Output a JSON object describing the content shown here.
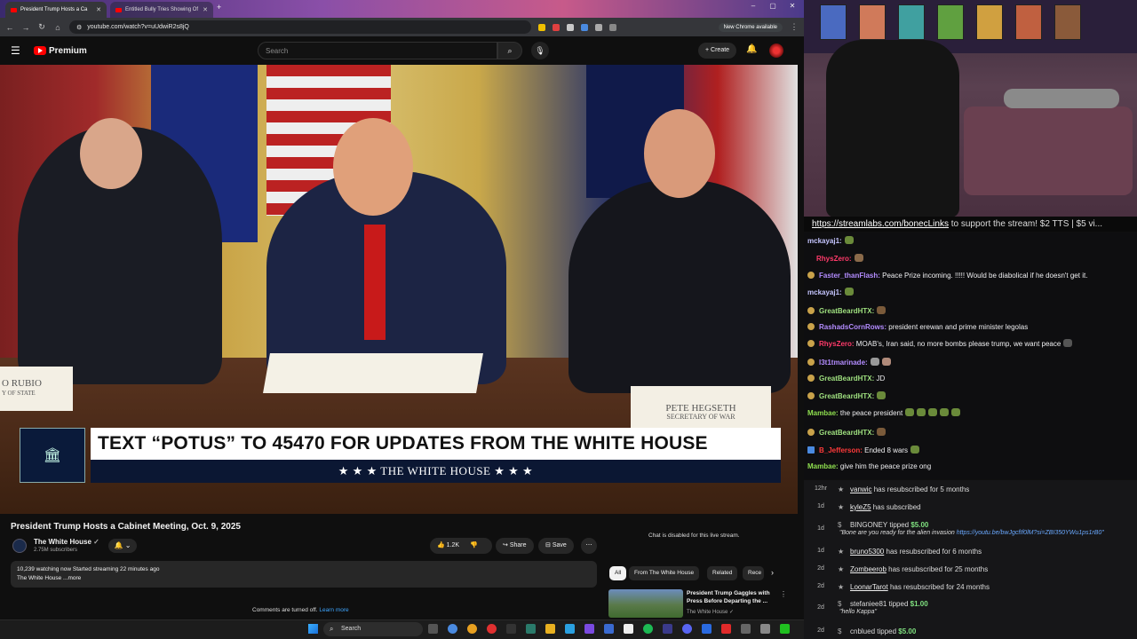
{
  "browser": {
    "tabs": [
      {
        "label": "President Trump Hosts a Ca"
      },
      {
        "label": "Entitled Bully Tries Showing Of"
      }
    ],
    "url": "youtube.com/watch?v=uUdwiR2s8jQ",
    "chrome_badge": "New Chrome available"
  },
  "youtube": {
    "logo": "Premium",
    "search_placeholder": "Search",
    "create_label": "Create",
    "video": {
      "banner_text": "TEXT “POTUS” TO 45470 FOR UPDATES FROM THE WHITE HOUSE",
      "banner_sub": "★ ★ ★   THE WHITE HOUSE   ★ ★ ★",
      "nameplate_left_name": "O RUBIO",
      "nameplate_left_title": "Y OF STATE",
      "nameplate_right_name": "PETE HEGSETH",
      "nameplate_right_title": "SECRETARY OF WAR"
    },
    "title": "President Trump Hosts a Cabinet Meeting, Oct. 9, 2025",
    "channel": "The White House",
    "subscribers": "2.75M subscribers",
    "likes": "1.2K",
    "share_label": "Share",
    "save_label": "Save",
    "description_line1": "10,239 watching now  Started streaming 22 minutes ago",
    "description_line2": "The White House ...more",
    "comments_off": "Comments are turned off.",
    "learn_more": "Learn more",
    "chat_disabled": "Chat is disabled for this live stream.",
    "chips": [
      "All",
      "From The White House",
      "Related",
      "Rece"
    ],
    "recommendation": {
      "title": "President Trump Gaggles with Press Before Departing the ...",
      "channel": "The White House"
    }
  },
  "taskbar": {
    "search": "Search"
  },
  "stream": {
    "ticker_link": "https://streamlabs.com/bonecLinks",
    "ticker_rest": " to support the stream! $2 TTS | $5 vi...",
    "chat": [
      {
        "user": "mckayaj1:",
        "color": "#c5c5ff",
        "text": ""
      },
      {
        "user": "RhysZero:",
        "color": "#ff3a6a",
        "text": ""
      },
      {
        "user": "Faster_thanFlash:",
        "color": "#b38cff",
        "text": "Peace Prize incoming. !!!!! Would be diabolical if he doesn't get it."
      },
      {
        "user": "mckayaj1:",
        "color": "#c5c5ff",
        "text": ""
      },
      {
        "user": "GreatBeardHTX:",
        "color": "#9fe07f",
        "text": ""
      },
      {
        "user": "RashadsCornRows:",
        "color": "#b38cff",
        "text": "president erewan and prime minister legolas"
      },
      {
        "user": "RhysZero:",
        "color": "#ff3a6a",
        "text": "MOAB's, Iran said, no more bombs please trump, we want peace"
      },
      {
        "user": "l3t1tmarinade:",
        "color": "#b38cff",
        "text": ""
      },
      {
        "user": "GreatBeardHTX:",
        "color": "#9fe07f",
        "text": "JD"
      },
      {
        "user": "GreatBeardHTX:",
        "color": "#9fe07f",
        "text": ""
      },
      {
        "user": "Mambae:",
        "color": "#8fe04f",
        "text": "the peace president"
      },
      {
        "user": "GreatBeardHTX:",
        "color": "#9fe07f",
        "text": ""
      },
      {
        "user": "B_Jefferson:",
        "color": "#ff3a3a",
        "text": "Ended 8 wars"
      },
      {
        "user": "Mambae:",
        "color": "#8fe04f",
        "text": "give him the peace prize ong"
      }
    ],
    "events": [
      {
        "time": "12hr",
        "name": "vanwic",
        "action": "has resubscribed for 5 months"
      },
      {
        "time": "1d",
        "name": "kyleZ5",
        "action": "has subscribed"
      },
      {
        "time": "1d",
        "name": "BINGONEY",
        "action": "tipped",
        "amount": "$5.00",
        "quote": "\"Bone are you ready for the alien invasion ",
        "quote_link": "https://youtu.be/bwJgcfIf0lM?si=ZBI350YWu1ps1rB0\""
      },
      {
        "time": "1d",
        "name": "bruno5300",
        "action": "has resubscribed for 6 months"
      },
      {
        "time": "2d",
        "name": "Zombeerob",
        "action": "has resubscribed for 25 months"
      },
      {
        "time": "2d",
        "name": "LoonarTarot",
        "action": "has resubscribed for 24 months"
      },
      {
        "time": "2d",
        "name": "stefaniee81",
        "action": "tipped",
        "amount": "$1.00",
        "quote": "\"hello Kappa\"",
        "quote_link": ""
      },
      {
        "time": "2d",
        "name": "cnblued",
        "action": "tipped",
        "amount": "$5.00"
      }
    ]
  }
}
